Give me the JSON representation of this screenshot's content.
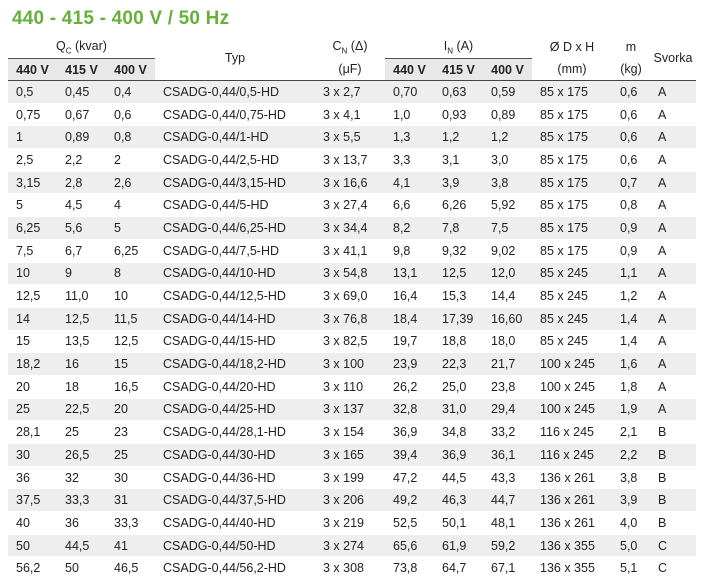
{
  "title": "440 - 415 - 400 V / 50 Hz",
  "header": {
    "qc": {
      "sym": "Q",
      "sub": "C",
      "unit": " (kvar)"
    },
    "typ": "Typ",
    "cn": {
      "sym": "C",
      "sub": "N",
      "unit": " (Δ)"
    },
    "cn_unit": "(μF)",
    "in": {
      "sym": "I",
      "sub": "N",
      "unit": " (A)"
    },
    "dim": "Ø D x H",
    "dim_unit": "(mm)",
    "m": "m",
    "m_unit": "(kg)",
    "svorka": "Svorka",
    "v440": "440 V",
    "v415": "415 V",
    "v400": "400 V"
  },
  "rows": [
    [
      "0,5",
      "0,45",
      "0,4",
      "CSADG-0,44/0,5-HD",
      "3 x 2,7",
      "0,70",
      "0,63",
      "0,59",
      "85 x 175",
      "0,6",
      "A"
    ],
    [
      "0,75",
      "0,67",
      "0,6",
      "CSADG-0,44/0,75-HD",
      "3 x 4,1",
      "1,0",
      "0,93",
      "0,89",
      "85 x 175",
      "0,6",
      "A"
    ],
    [
      "1",
      "0,89",
      "0,8",
      "CSADG-0,44/1-HD",
      "3 x 5,5",
      "1,3",
      "1,2",
      "1,2",
      "85 x 175",
      "0,6",
      "A"
    ],
    [
      "2,5",
      "2,2",
      "2",
      "CSADG-0,44/2,5-HD",
      "3 x 13,7",
      "3,3",
      "3,1",
      "3,0",
      "85 x 175",
      "0,6",
      "A"
    ],
    [
      "3,15",
      "2,8",
      "2,6",
      "CSADG-0,44/3,15-HD",
      "3 x 16,6",
      "4,1",
      "3,9",
      "3,8",
      "85 x 175",
      "0,7",
      "A"
    ],
    [
      "5",
      "4,5",
      "4",
      "CSADG-0,44/5-HD",
      "3 x 27,4",
      "6,6",
      "6,26",
      "5,92",
      "85 x 175",
      "0,8",
      "A"
    ],
    [
      "6,25",
      "5,6",
      "5",
      "CSADG-0,44/6,25-HD",
      "3 x 34,4",
      "8,2",
      "7,8",
      "7,5",
      "85 x 175",
      "0,9",
      "A"
    ],
    [
      "7,5",
      "6,7",
      "6,25",
      "CSADG-0,44/7,5-HD",
      "3 x 41,1",
      "9,8",
      "9,32",
      "9,02",
      "85 x 175",
      "0,9",
      "A"
    ],
    [
      "10",
      "9",
      "8",
      "CSADG-0,44/10-HD",
      "3 x 54,8",
      "13,1",
      "12,5",
      "12,0",
      "85 x 245",
      "1,1",
      "A"
    ],
    [
      "12,5",
      "11,0",
      "10",
      "CSADG-0,44/12,5-HD",
      "3 x 69,0",
      "16,4",
      "15,3",
      "14,4",
      "85 x 245",
      "1,2",
      "A"
    ],
    [
      "14",
      "12,5",
      "11,5",
      "CSADG-0,44/14-HD",
      "3 x 76,8",
      "18,4",
      "17,39",
      "16,60",
      "85 x 245",
      "1,4",
      "A"
    ],
    [
      "15",
      "13,5",
      "12,5",
      "CSADG-0,44/15-HD",
      "3 x 82,5",
      "19,7",
      "18,8",
      "18,0",
      "85 x 245",
      "1,4",
      "A"
    ],
    [
      "18,2",
      "16",
      "15",
      "CSADG-0,44/18,2-HD",
      "3 x 100",
      "23,9",
      "22,3",
      "21,7",
      "100 x 245",
      "1,6",
      "A"
    ],
    [
      "20",
      "18",
      "16,5",
      "CSADG-0,44/20-HD",
      "3 x 110",
      "26,2",
      "25,0",
      "23,8",
      "100 x 245",
      "1,8",
      "A"
    ],
    [
      "25",
      "22,5",
      "20",
      "CSADG-0,44/25-HD",
      "3 x 137",
      "32,8",
      "31,0",
      "29,4",
      "100 x 245",
      "1,9",
      "A"
    ],
    [
      "28,1",
      "25",
      "23",
      "CSADG-0,44/28,1-HD",
      "3 x 154",
      "36,9",
      "34,8",
      "33,2",
      "116 x 245",
      "2,1",
      "B"
    ],
    [
      "30",
      "26,5",
      "25",
      "CSADG-0,44/30-HD",
      "3 x 165",
      "39,4",
      "36,9",
      "36,1",
      "116 x 245",
      "2,2",
      "B"
    ],
    [
      "36",
      "32",
      "30",
      "CSADG-0,44/36-HD",
      "3 x 199",
      "47,2",
      "44,5",
      "43,3",
      "136 x 261",
      "3,8",
      "B"
    ],
    [
      "37,5",
      "33,3",
      "31",
      "CSADG-0,44/37,5-HD",
      "3 x 206",
      "49,2",
      "46,3",
      "44,7",
      "136 x 261",
      "3,9",
      "B"
    ],
    [
      "40",
      "36",
      "33,3",
      "CSADG-0,44/40-HD",
      "3 x 219",
      "52,5",
      "50,1",
      "48,1",
      "136 x 261",
      "4,0",
      "B"
    ],
    [
      "50",
      "44,5",
      "41",
      "CSADG-0,44/50-HD",
      "3 x 274",
      "65,6",
      "61,9",
      "59,2",
      "136 x 355",
      "5,0",
      "C"
    ],
    [
      "56,2",
      "50",
      "46,5",
      "CSADG-0,44/56,2-HD",
      "3 x 308",
      "73,8",
      "64,7",
      "67,1",
      "136 x 355",
      "5,1",
      "C"
    ]
  ]
}
